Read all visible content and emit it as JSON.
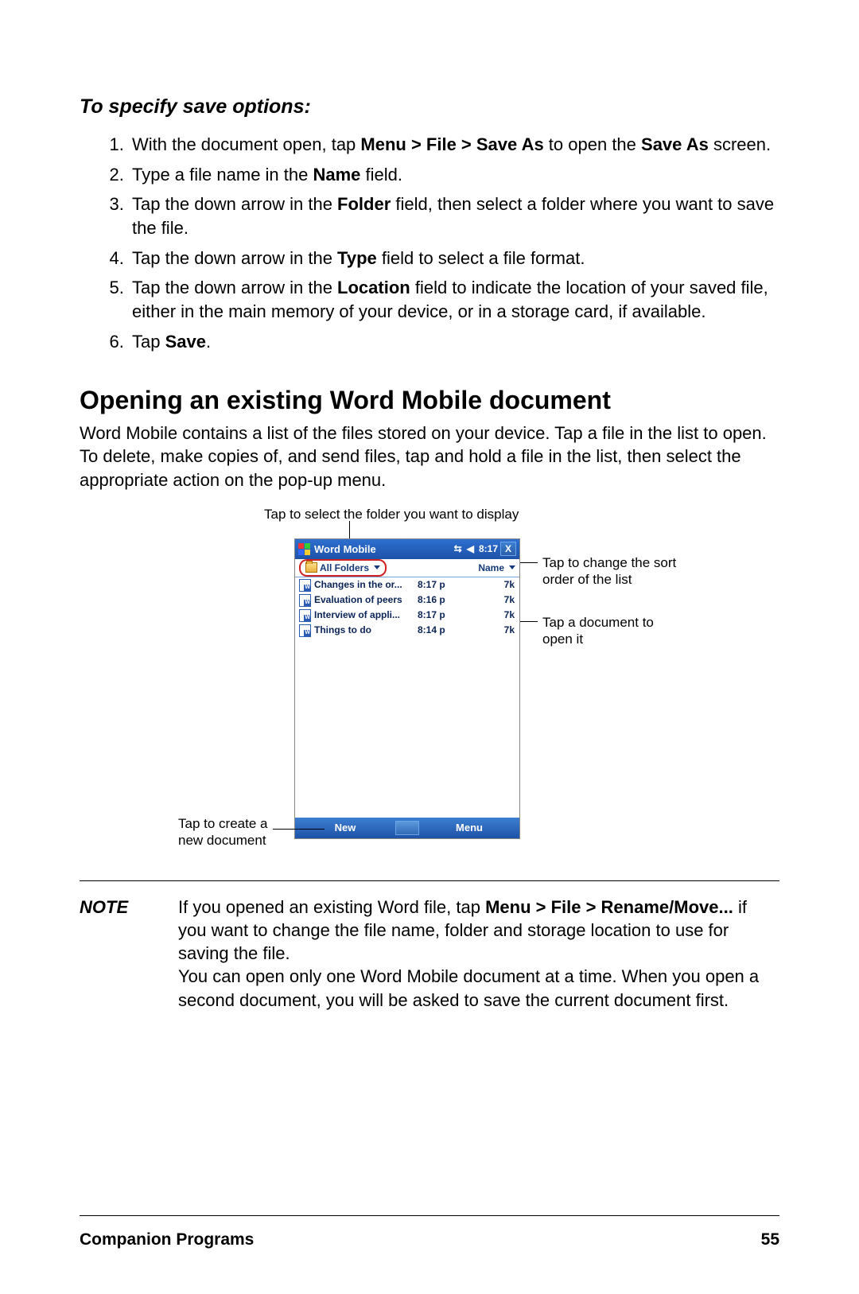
{
  "section_sub": "To specify save options:",
  "steps": [
    {
      "pre": "With the document open, tap ",
      "bold": "Menu > File > Save As",
      "mid": " to open the ",
      "bold2": "Save As",
      "post": " screen."
    },
    {
      "pre": "Type a file name in the ",
      "bold": "Name",
      "post": " field."
    },
    {
      "pre": "Tap the down arrow in the ",
      "bold": "Folder",
      "post": " field, then select a folder where you want to save the file."
    },
    {
      "pre": "Tap the down arrow in the ",
      "bold": "Type",
      "post": " field to select a file format."
    },
    {
      "pre": "Tap the down arrow in the ",
      "bold": "Location",
      "post": " field to indicate the location of your saved file, either in the main memory of your device, or in a storage card, if available."
    },
    {
      "pre": "Tap ",
      "bold": "Save",
      "post": "."
    }
  ],
  "section_head": "Opening an existing Word Mobile document",
  "section_body": "Word Mobile contains a list of the files stored on your device. Tap a file in the list to open. To delete, make copies of, and send files, tap and hold a file in the list, then select the appropriate action on the pop-up menu.",
  "figure": {
    "caption_top": "Tap to select the folder you want to display",
    "callout_sort": "Tap to change the sort order of the list",
    "callout_open": "Tap a document to open it",
    "callout_new": "Tap to create a new document",
    "titlebar": {
      "title": "Word Mobile",
      "time": "8:17",
      "close": "X"
    },
    "folderbar": {
      "folders": "All Folders",
      "name": "Name"
    },
    "files": [
      {
        "name": "Changes in the or...",
        "time": "8:17 p",
        "size": "7k"
      },
      {
        "name": "Evaluation of peers",
        "time": "8:16 p",
        "size": "7k"
      },
      {
        "name": "Interview of appli...",
        "time": "8:17 p",
        "size": "7k"
      },
      {
        "name": "Things to do",
        "time": "8:14 p",
        "size": "7k"
      }
    ],
    "softkeys": {
      "new": "New",
      "menu": "Menu"
    }
  },
  "note": {
    "label": "NOTE",
    "line1_pre": "If you opened an existing Word file, tap ",
    "line1_bold": "Menu > File > Rename/Move...",
    "line1_post": " if you want to change the file name, folder and storage location to use for saving the file.",
    "line2": "You can open only one Word Mobile document at a time. When you open a second document, you will be asked to save the current document first."
  },
  "footer": {
    "section": "Companion Programs",
    "page": "55"
  }
}
